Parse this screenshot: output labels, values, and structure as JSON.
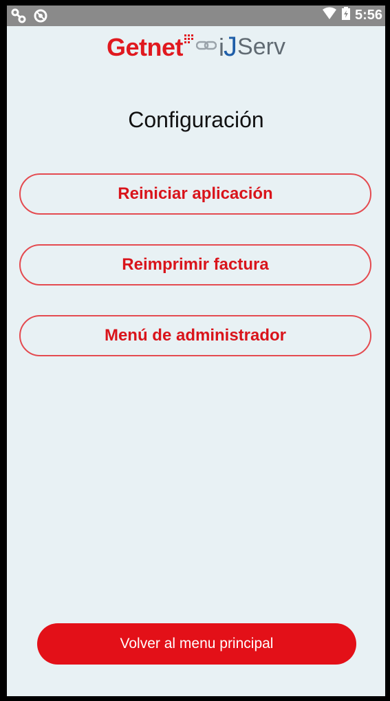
{
  "status_bar": {
    "left_icons": [
      "link-icon",
      "block-icon"
    ],
    "right_icons": [
      "wifi-icon",
      "battery-icon"
    ],
    "time": "5:56"
  },
  "logo": {
    "brand": "Getnet",
    "partner_i": "i",
    "partner_j": "J",
    "partner_serv": "Serv",
    "brand_color": "#e0191f",
    "partner_color": "#606a72",
    "partner_accent": "#1f5ea8"
  },
  "page": {
    "title": "Configuración"
  },
  "options": [
    {
      "label": "Reiniciar aplicación"
    },
    {
      "label": "Reimprimir factura"
    },
    {
      "label": "Menú de administrador"
    }
  ],
  "footer": {
    "back_label": "Volver al menu principal"
  },
  "colors": {
    "accent": "#e31018",
    "background": "#e8f1f4",
    "statusbar": "#8a8a8a"
  }
}
